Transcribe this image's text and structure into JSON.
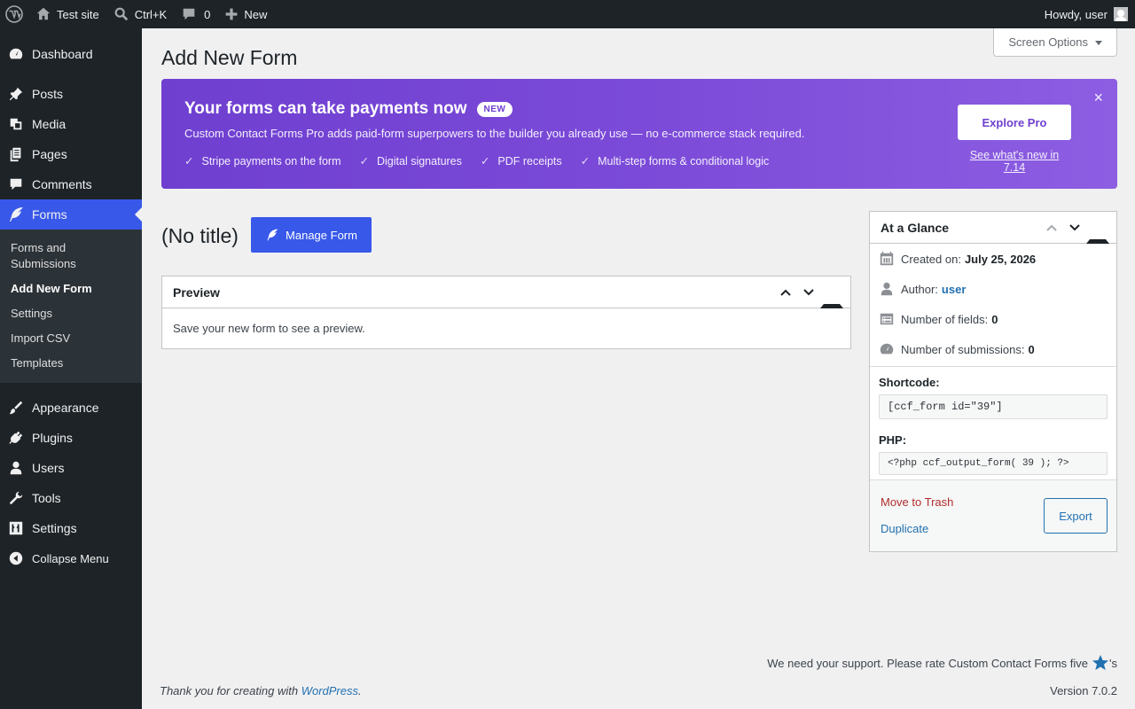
{
  "adminbar": {
    "site_name": "Test site",
    "search_shortcut": "Ctrl+K",
    "comments_count": "0",
    "new_label": "New",
    "howdy": "Howdy, user"
  },
  "sidebar": {
    "items": [
      {
        "label": "Dashboard",
        "icon": "dashboard-icon"
      },
      {
        "label": "Posts",
        "icon": "pin-icon"
      },
      {
        "label": "Media",
        "icon": "media-icon"
      },
      {
        "label": "Pages",
        "icon": "pages-icon"
      },
      {
        "label": "Comments",
        "icon": "comment-icon"
      },
      {
        "label": "Forms",
        "icon": "feather-icon"
      },
      {
        "label": "Appearance",
        "icon": "brush-icon"
      },
      {
        "label": "Plugins",
        "icon": "plug-icon"
      },
      {
        "label": "Users",
        "icon": "user-icon"
      },
      {
        "label": "Tools",
        "icon": "wrench-icon"
      },
      {
        "label": "Settings",
        "icon": "sliders-icon"
      },
      {
        "label": "Collapse Menu",
        "icon": "collapse-icon"
      }
    ],
    "forms_submenu": [
      "Forms and Submissions",
      "Add New Form",
      "Settings",
      "Import CSV",
      "Templates"
    ]
  },
  "screen_options": "Screen Options",
  "page_title": "Add New Form",
  "promo": {
    "title": "Your forms can take payments now",
    "badge": "NEW",
    "description": "Custom Contact Forms Pro adds paid-form superpowers to the builder you already use — no e-commerce stack required.",
    "features": [
      "Stripe payments on the form",
      "Digital signatures",
      "PDF receipts",
      "Multi-step forms & conditional logic"
    ],
    "button": "Explore Pro",
    "link": "See what's new in 7.14",
    "close": "×",
    "color": "#7b4ad8"
  },
  "form": {
    "title": "(No title)",
    "manage_button": "Manage Form"
  },
  "preview": {
    "heading": "Preview",
    "message": "Save your new form to see a preview."
  },
  "glance": {
    "heading": "At a Glance",
    "created_label": "Created on:",
    "created_value": "July 25, 2026",
    "author_label": "Author:",
    "author_value": "user",
    "fields_label": "Number of fields:",
    "fields_value": "0",
    "submissions_label": "Number of submissions:",
    "submissions_value": "0",
    "shortcode_label": "Shortcode:",
    "shortcode_value": "[ccf_form id=\"39\"]",
    "php_label": "PHP:",
    "php_value": "<?php ccf_output_form( 39 ); ?>",
    "trash": "Move to Trash",
    "duplicate": "Duplicate",
    "export": "Export"
  },
  "footer": {
    "rate_text": "We need your support. Please rate Custom Contact Forms five",
    "rate_suffix": "'s",
    "thanks_prefix": "Thank you for creating with ",
    "thanks_link": "WordPress",
    "thanks_suffix": ".",
    "version": "Version 7.0.2"
  }
}
